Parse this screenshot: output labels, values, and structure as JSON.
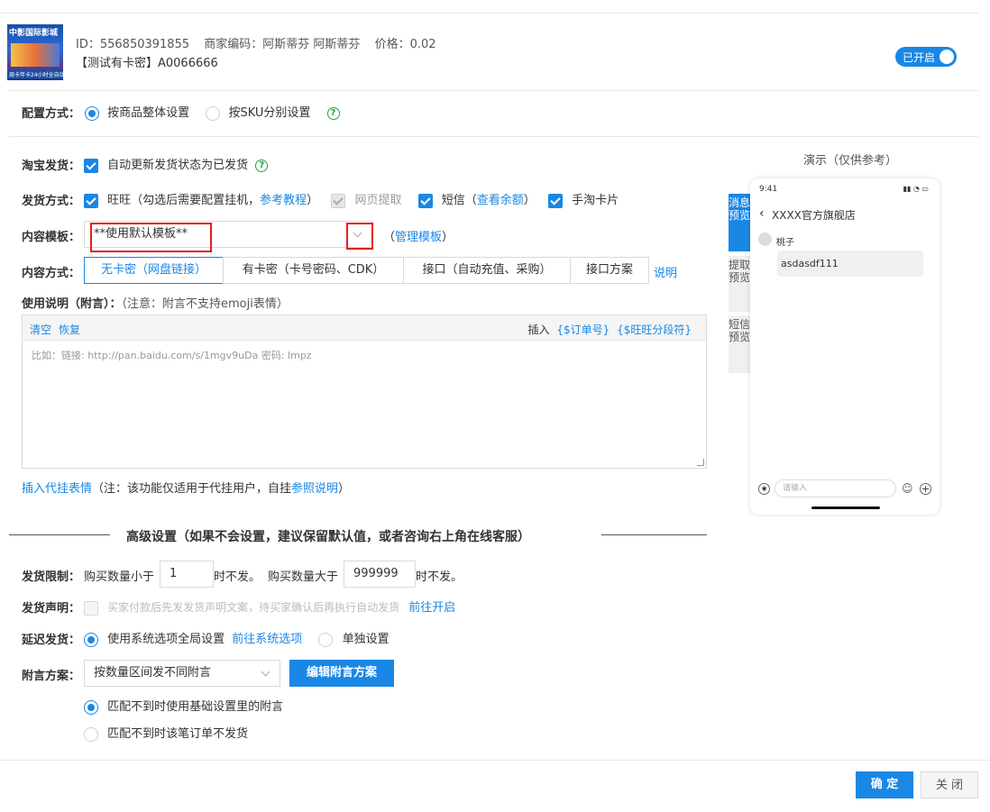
{
  "product": {
    "thumb_title": "中影国际影城",
    "thumb_caption": "周卡年卡24小时全自动发货",
    "id_label": "ID：",
    "id_value": "556850391855",
    "merchant_label": "商家编码：",
    "merchant_value": "阿斯蒂芬 阿斯蒂芬",
    "price_label": "价格：",
    "price_value": "0.02",
    "name": "【测试有卡密】A0066666",
    "toggle_label": "已开启"
  },
  "config": {
    "label": "配置方式：",
    "option_whole": "按商品整体设置",
    "option_sku": "按SKU分别设置"
  },
  "taobao": {
    "label": "淘宝发货：",
    "auto_update": "自动更新发货状态为已发货"
  },
  "delivery": {
    "label": "发货方式：",
    "wangwang": "旺旺（勾选后需要配置挂机，",
    "tutorial": "参考教程",
    "close_paren": "）",
    "webpage": "网页提取",
    "sms": "短信（",
    "balance": "查看余额",
    "sms_close": "）",
    "handtao": "手淘卡片"
  },
  "template": {
    "label": "内容模板：",
    "value": "**使用默认模板**",
    "manage_open": "（",
    "manage": "管理模板",
    "manage_close": "）"
  },
  "content_mode": {
    "label": "内容方式：",
    "tabs": [
      "无卡密（网盘链接）",
      "有卡密（卡号密码、CDK）",
      "接口（自动充值、采购）",
      "接口方案"
    ],
    "explain": "说明"
  },
  "notes": {
    "label": "使用说明（附言）：",
    "hint": "（注意：附言不支持emoji表情）",
    "clear": "清空",
    "restore": "恢复",
    "insert": "插入",
    "order_no": "{$订单号}",
    "ww_seg": "{$旺旺分段符}",
    "placeholder": "比如：链接: http://pan.baidu.com/s/1mgv9uDa 密码: lmpz"
  },
  "insert_emoji": {
    "link": "插入代挂表情",
    "note": "（注：该功能仅适用于代挂用户，自挂",
    "ref": "参照说明",
    "close": "）"
  },
  "advanced": {
    "title": "高级设置（如果不会设置，建议保留默认值，或者咨询右上角在线客服）"
  },
  "limit": {
    "label": "发货限制：",
    "less_prefix": "购买数量小于",
    "less_value": "1",
    "less_suffix": "时不发。",
    "more_prefix": "购买数量大于",
    "more_value": "999999",
    "more_suffix": "时不发。"
  },
  "statement": {
    "label": "发货声明：",
    "text": "买家付款后先发发货声明文案，待买家确认后再执行自动发货",
    "link": "前往开启"
  },
  "delay": {
    "label": "延迟发货：",
    "global": "使用系统选项全局设置",
    "goto": "前往系统选项",
    "single": "单独设置"
  },
  "scheme": {
    "label": "附言方案：",
    "select": "按数量区间发不同附言",
    "edit": "编辑附言方案",
    "opt1": "匹配不到时使用基础设置里的附言",
    "opt2": "匹配不到时该笔订单不发货"
  },
  "preview": {
    "title": "演示（仅供参考）",
    "tabs": [
      "消息预览",
      "提取预览",
      "短信预览"
    ],
    "time": "9:41",
    "shop": "XXXX官方旗舰店",
    "user": "桃子",
    "message": "asdasdf111",
    "input_placeholder": "请输入"
  },
  "footer": {
    "confirm": "确 定",
    "close": "关 闭"
  },
  "colors": {
    "accent": "#1a87e5",
    "highlight": "#e02020",
    "help": "#22a146"
  }
}
